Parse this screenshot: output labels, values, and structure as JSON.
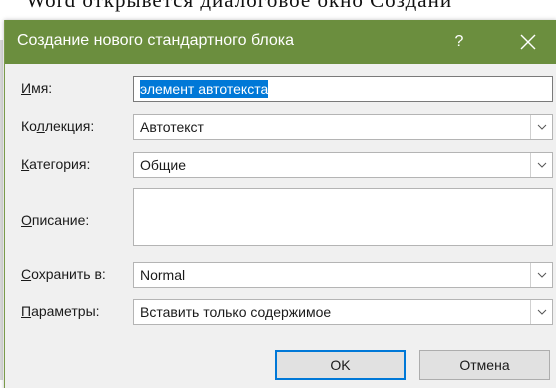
{
  "background": {
    "doc_text": "Word открывется диалоговое окно Создани"
  },
  "dialog": {
    "title": "Создание нового стандартного блока",
    "help_label": "?",
    "fields": {
      "name": {
        "label_acc": "И",
        "label_rest": "мя:",
        "value": "элемент автотекста"
      },
      "gallery": {
        "label_pre": "Ко",
        "label_acc": "л",
        "label_rest": "лекция:",
        "value": "Автотекст"
      },
      "category": {
        "label_acc": "К",
        "label_rest": "атегория:",
        "value": "Общие"
      },
      "description": {
        "label_acc": "О",
        "label_rest": "писание:",
        "value": ""
      },
      "save_in": {
        "label_acc": "С",
        "label_rest": "охранить в:",
        "value": "Normal"
      },
      "options": {
        "label_acc": "П",
        "label_rest": "араметры:",
        "value": "Вставить только содержимое"
      }
    },
    "buttons": {
      "ok": "OK",
      "cancel": "Отмена"
    }
  },
  "colors": {
    "titlebar": "#6b8e3e",
    "selection": "#0078d7",
    "focus_border": "#0078d7"
  }
}
